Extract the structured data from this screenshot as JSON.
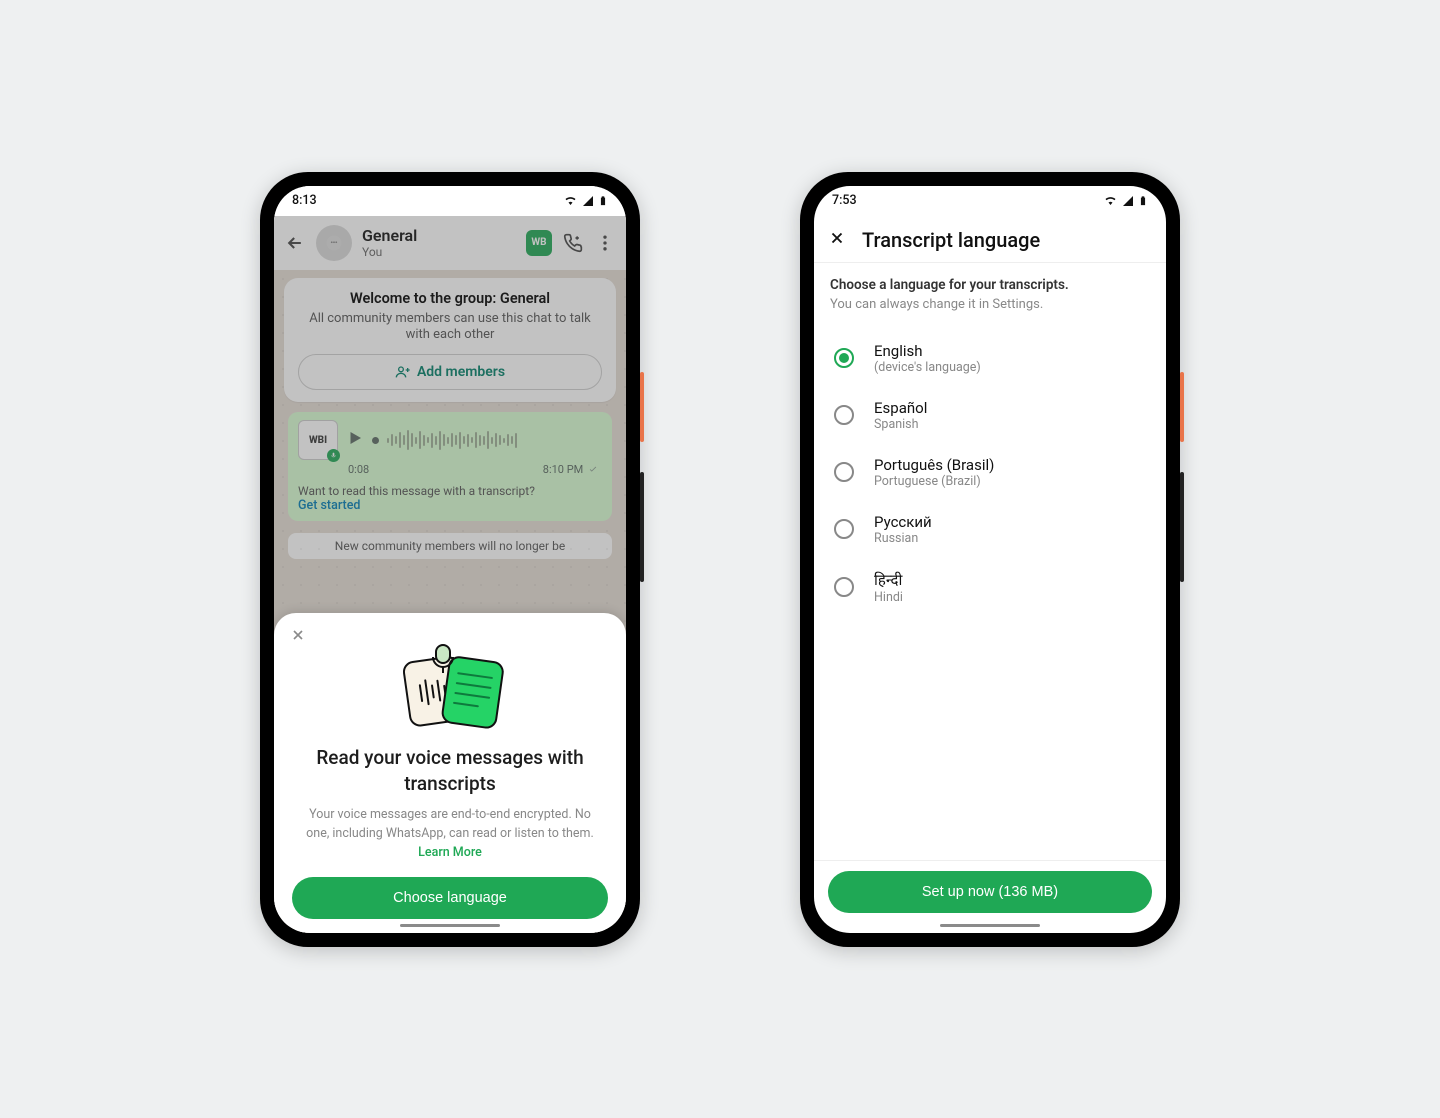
{
  "phone1": {
    "status_time": "8:13",
    "chat": {
      "title": "General",
      "subtitle": "You"
    },
    "group_card": {
      "title": "Welcome to the group: General",
      "subtitle": "All community members can use this chat to talk with each other",
      "add_members_label": "Add members"
    },
    "voice": {
      "sender": "WBI",
      "duration": "0:08",
      "time": "8:10 PM",
      "hint": "Want to read this message with a transcript?",
      "link": "Get started"
    },
    "sys_msg": "New community members will no longer be",
    "sheet": {
      "title": "Read your voice messages with transcripts",
      "body": "Your voice messages are end-to-end encrypted. No one, including WhatsApp, can read or listen to them. ",
      "learn_more": "Learn More",
      "button": "Choose language"
    }
  },
  "phone2": {
    "status_time": "7:53",
    "title": "Transcript language",
    "body_title": "Choose a language for your transcripts.",
    "body_sub": "You can always change it in Settings.",
    "languages": [
      {
        "name": "English",
        "sub": "(device's language)",
        "selected": true
      },
      {
        "name": "Español",
        "sub": "Spanish",
        "selected": false
      },
      {
        "name": "Português (Brasil)",
        "sub": "Portuguese (Brazil)",
        "selected": false
      },
      {
        "name": "Русский",
        "sub": "Russian",
        "selected": false
      },
      {
        "name": "हिन्दी",
        "sub": "Hindi",
        "selected": false
      }
    ],
    "button": "Set up now (136 MB)"
  }
}
